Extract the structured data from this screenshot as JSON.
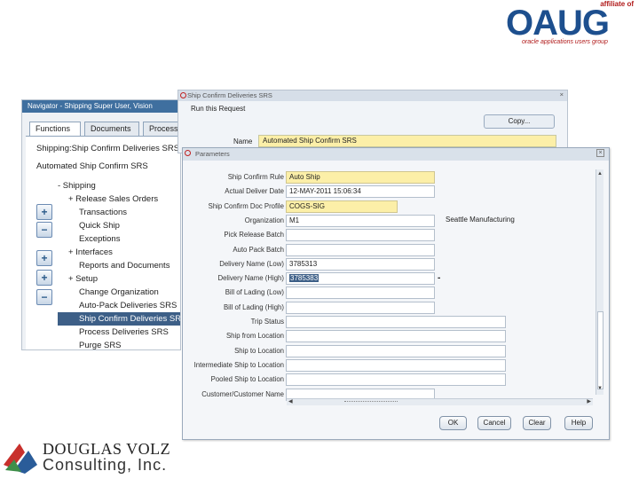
{
  "oaug": {
    "affiliate": "affiliate of",
    "wordmark": "OAUG",
    "tagline": "oracle applications users group"
  },
  "navigator": {
    "title": "Navigator - Shipping Super User, Vision",
    "tabs": [
      "Functions",
      "Documents",
      "Process"
    ],
    "path": "Shipping:Ship Confirm Deliveries SRS",
    "selected_function": "Automated Ship Confirm SRS",
    "buttons": [
      "+",
      "−",
      "+",
      "+",
      "−"
    ],
    "tree": [
      {
        "label": "- Shipping",
        "indent": 0
      },
      {
        "label": "+ Release Sales Orders",
        "indent": 1
      },
      {
        "label": "Transactions",
        "indent": 2
      },
      {
        "label": "Quick Ship",
        "indent": 2
      },
      {
        "label": "Exceptions",
        "indent": 2
      },
      {
        "label": "+ Interfaces",
        "indent": 1
      },
      {
        "label": "Reports and Documents",
        "indent": 2
      },
      {
        "label": "+ Setup",
        "indent": 1
      },
      {
        "label": "Change Organization",
        "indent": 2
      },
      {
        "label": "Auto-Pack Deliveries SRS",
        "indent": 2
      },
      {
        "label": "Ship Confirm Deliveries SRS",
        "indent": 2,
        "selected": true
      },
      {
        "label": "Process Deliveries SRS",
        "indent": 2
      },
      {
        "label": "Purge SRS",
        "indent": 2
      }
    ]
  },
  "submit_request": {
    "title": "Ship Confirm Deliveries SRS",
    "run_label": "Run this Request",
    "copy_label": "Copy...",
    "name_label": "Name",
    "name_value": "Automated Ship Confirm SRS"
  },
  "parameters": {
    "title": "Parameters",
    "close": "×",
    "rows": [
      {
        "label": "Ship Confirm Rule",
        "value": "Auto Ship",
        "required": true,
        "width": "wide"
      },
      {
        "label": "Actual Deliver Date",
        "value": "12-MAY-2011 15:06:34",
        "required": false,
        "width": "wide"
      },
      {
        "label": "Ship Confirm Doc Profile",
        "value": "COGS-SIG",
        "required": true,
        "width": "medium"
      },
      {
        "label": "Organization",
        "value": "M1",
        "required": false,
        "width": "wide"
      },
      {
        "label": "Pick Release Batch",
        "value": "",
        "required": false,
        "width": "wide"
      },
      {
        "label": "Auto Pack Batch",
        "value": "",
        "required": false,
        "width": "wide"
      },
      {
        "label": "Delivery Name (Low)",
        "value": "3785313",
        "required": false,
        "width": "wide"
      },
      {
        "label": "Delivery Name (High)",
        "value": "3785383",
        "required": false,
        "width": "wide",
        "selected": true
      },
      {
        "label": "Bill of Lading (Low)",
        "value": "",
        "required": false,
        "width": "wide"
      },
      {
        "label": "Bill of Lading (High)",
        "value": "",
        "required": false,
        "width": "wide"
      },
      {
        "label": "Trip Status",
        "value": "",
        "required": false,
        "width": "long"
      },
      {
        "label": "Ship from Location",
        "value": "",
        "required": false,
        "width": "long"
      },
      {
        "label": "Ship to Location",
        "value": "",
        "required": false,
        "width": "long"
      },
      {
        "label": "Intermediate Ship to Location",
        "value": "",
        "required": false,
        "width": "long"
      },
      {
        "label": "Pooled Ship to Location",
        "value": "",
        "required": false,
        "width": "long"
      },
      {
        "label": "Customer/Customer Name",
        "value": "",
        "required": false,
        "width": "wide"
      }
    ],
    "org_description": "Seattle Manufacturing",
    "buttons": {
      "ok": "OK",
      "cancel": "Cancel",
      "clear": "Clear",
      "help": "Help"
    }
  },
  "douglas_volz": {
    "line1": "DOUGLAS VOLZ",
    "line2": "Consulting, Inc.",
    "colors": {
      "red": "#c8302c",
      "blue": "#2a5c99",
      "green": "#3e8f4a"
    }
  }
}
